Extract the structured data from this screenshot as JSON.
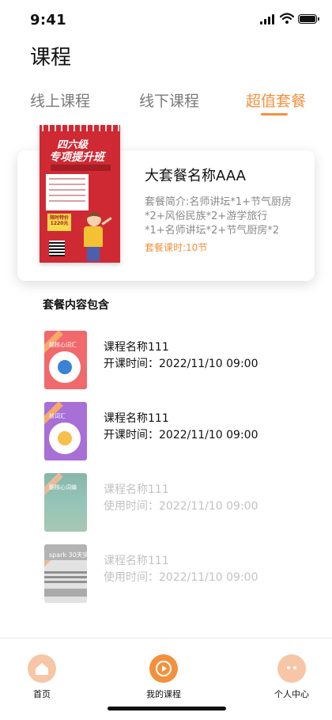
{
  "status_bar": {
    "time": "9:41"
  },
  "page_title": "课程",
  "tabs": [
    {
      "label": "线上课程",
      "active": false
    },
    {
      "label": "线下课程",
      "active": false
    },
    {
      "label": "超值套餐",
      "active": true
    }
  ],
  "package": {
    "poster": {
      "title_line1": "四六级",
      "title_line2": "专项提升班",
      "price_label": "限时特价 1220元"
    },
    "name": "大套餐名称AAA",
    "description": "套餐简介:名师讲坛*1+节气厨房*2+风俗民族*2+游学旅行*1+名师讲坛*2+节气厨房*2",
    "hours": "套餐课时:10节"
  },
  "section_title": "套餐内容包含",
  "courses": [
    {
      "thumb_tag": "翻核心词汇",
      "title": "课程名称111",
      "time": "开课时间：2022/11/10 09:00",
      "thumb_color": "#f0696c",
      "dot_color": "#3a82d6",
      "dim": false
    },
    {
      "thumb_tag": "核词汇",
      "title": "课程名称111",
      "time": "开课时间：2022/11/10 09:00",
      "thumb_color": "#a86fd6",
      "dot_color": "#f6c04a",
      "dim": false
    },
    {
      "thumb_tag": "翻核心词编",
      "title": "课程名称111",
      "time": "使用时间：2022/11/10 09:00",
      "thumb_color": "#5d9e8a",
      "dot_color": "",
      "dim": true
    },
    {
      "thumb_tag": "spark 30天突破",
      "title": "课程名称111",
      "time": "使用时间：2022/11/10 09:00",
      "thumb_color": "#9a9a9a",
      "dot_color": "",
      "dim": true
    }
  ],
  "bottom_nav": [
    {
      "label": "首页",
      "icon": "home-icon",
      "color": "#f7c6a6"
    },
    {
      "label": "我的课程",
      "icon": "play-icon",
      "color": "#f2913d"
    },
    {
      "label": "个人中心",
      "icon": "profile-icon",
      "color": "#f7c6a6"
    }
  ],
  "colors": {
    "accent": "#f2913d",
    "muted": "#8a8a8a"
  }
}
